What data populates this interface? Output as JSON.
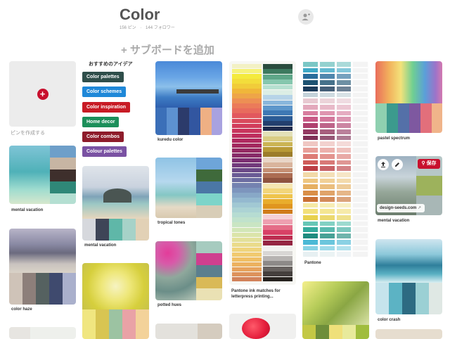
{
  "board": {
    "title": "Color",
    "pins_count": "156 ピン",
    "followers_count": "144 フォロワー",
    "add_section": "+ サブボードを追加"
  },
  "create_pin": {
    "label": "ピンを作成する"
  },
  "ideas": {
    "title": "おすすめのアイデア",
    "items": [
      {
        "label": "Color palettes",
        "color": "#2f4e4a"
      },
      {
        "label": "Color schemes",
        "color": "#1f88d8"
      },
      {
        "label": "Color inspiration",
        "color": "#c81b25"
      },
      {
        "label": "Home decor",
        "color": "#1c8f5a"
      },
      {
        "label": "Color combos",
        "color": "#8e1c2b"
      },
      {
        "label": "Colour palettes",
        "color": "#7a52a3"
      }
    ]
  },
  "pins": [
    {
      "label": "mental vacation"
    },
    {
      "label": "color haze"
    },
    {
      "label": "mental vacation"
    },
    {
      "label": "kuredu color"
    },
    {
      "label": "tropical tones"
    },
    {
      "label": "potted hues"
    },
    {
      "label": "Pantone ink matches for letterpress printing..."
    },
    {
      "label": "Pantone"
    },
    {
      "label": "pastel spectrum"
    },
    {
      "label": "mental vacation"
    },
    {
      "label": "color crash"
    }
  ],
  "hover_pin": {
    "save_label": "保存",
    "source": "design-seeds.com"
  },
  "icons": {
    "collab": "add-collaborator-icon",
    "plus": "plus-icon",
    "share": "share-icon",
    "edit": "pencil-icon",
    "pin": "pin-icon",
    "external": "external-link-icon"
  }
}
